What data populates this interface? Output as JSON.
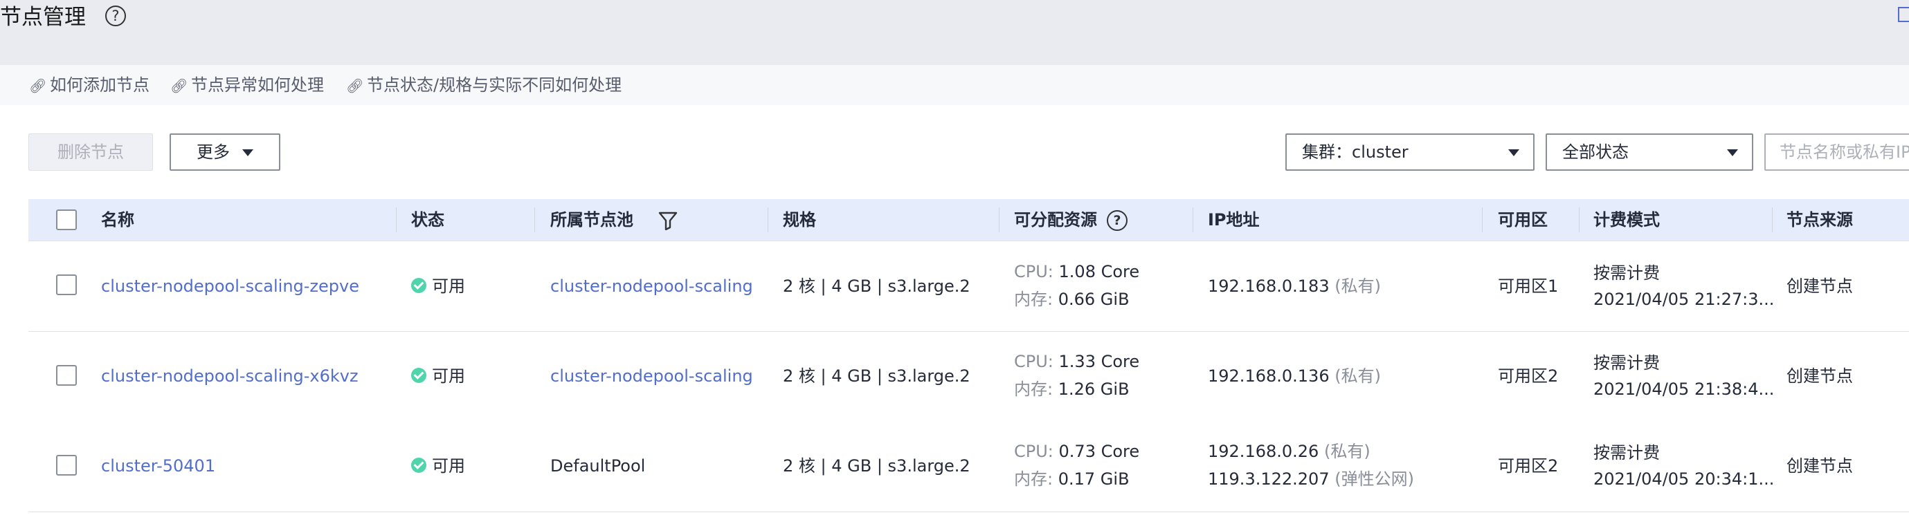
{
  "header": {
    "title": "节点管理",
    "help_glyph": "?"
  },
  "help_links": [
    "如何添加节点",
    "节点异常如何处理",
    "节点状态/规格与实际不同如何处理"
  ],
  "toolbar": {
    "delete_label": "删除节点",
    "more_label": "更多",
    "cluster_select": "集群：cluster",
    "status_select": "全部状态",
    "search_placeholder": "节点名称或私有IP"
  },
  "table": {
    "columns": {
      "name": "名称",
      "status": "状态",
      "pool": "所属节点池",
      "spec": "规格",
      "resources": "可分配资源",
      "ip": "IP地址",
      "zone": "可用区",
      "billing": "计费模式",
      "source": "节点来源"
    },
    "rows": [
      {
        "name": "cluster-nodepool-scaling-zepve",
        "status": "可用",
        "pool": "cluster-nodepool-scaling",
        "spec": "2 核 | 4 GB | s3.large.2",
        "cpu_label": "CPU:",
        "cpu": "1.08 Core",
        "mem_label": "内存:",
        "mem": "0.66 GiB",
        "ip1": "192.168.0.183",
        "ip1_tag": "(私有)",
        "ip2": "",
        "ip2_tag": "",
        "zone": "可用区1",
        "billing": "按需计费",
        "billing_time": "2021/04/05 21:27:3...",
        "source": "创建节点"
      },
      {
        "name": "cluster-nodepool-scaling-x6kvz",
        "status": "可用",
        "pool": "cluster-nodepool-scaling",
        "spec": "2 核 | 4 GB | s3.large.2",
        "cpu_label": "CPU:",
        "cpu": "1.33 Core",
        "mem_label": "内存:",
        "mem": "1.26 GiB",
        "ip1": "192.168.0.136",
        "ip1_tag": "(私有)",
        "ip2": "",
        "ip2_tag": "",
        "zone": "可用区2",
        "billing": "按需计费",
        "billing_time": "2021/04/05 21:38:4...",
        "source": "创建节点"
      },
      {
        "name": "cluster-50401",
        "status": "可用",
        "pool": "DefaultPool",
        "spec": "2 核 | 4 GB | s3.large.2",
        "cpu_label": "CPU:",
        "cpu": "0.73 Core",
        "mem_label": "内存:",
        "mem": "0.17 GiB",
        "ip1": "192.168.0.26",
        "ip1_tag": "(私有)",
        "ip2": "119.3.122.207",
        "ip2_tag": "(弹性公网)",
        "zone": "可用区2",
        "billing": "按需计费",
        "billing_time": "2021/04/05 20:34:1...",
        "source": "创建节点"
      }
    ]
  }
}
